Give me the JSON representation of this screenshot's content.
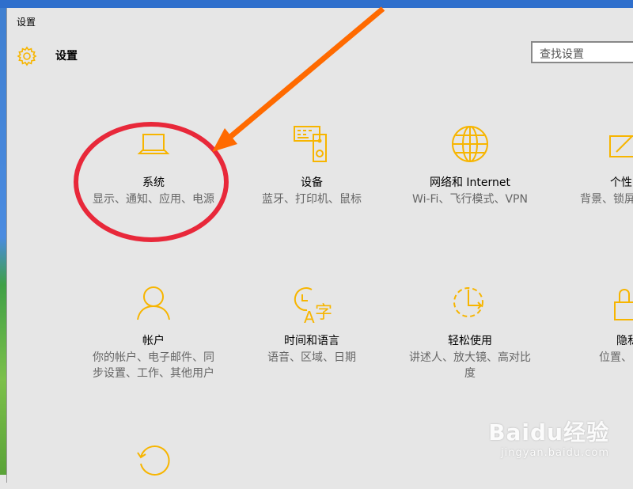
{
  "window": {
    "title": "设置"
  },
  "header": {
    "title": "设置",
    "search_placeholder": "查找设置"
  },
  "accent_color": "#f7b500",
  "annotation_colors": {
    "arrow": "#ff6a00",
    "circle": "#e8283a"
  },
  "tiles": [
    {
      "icon": "laptop-icon",
      "title": "系统",
      "desc": "显示、通知、应用、电源"
    },
    {
      "icon": "devices-icon",
      "title": "设备",
      "desc": "蓝牙、打印机、鼠标"
    },
    {
      "icon": "globe-icon",
      "title": "网络和 Internet",
      "desc": "Wi-Fi、飞行模式、VPN"
    },
    {
      "icon": "personalization-icon",
      "title": "个性",
      "desc": "背景、锁屏"
    },
    {
      "icon": "person-icon",
      "title": "帐户",
      "desc": "你的帐户、电子邮件、同步设置、工作、其他用户"
    },
    {
      "icon": "time-language-icon",
      "title": "时间和语言",
      "desc": "语音、区域、日期"
    },
    {
      "icon": "ease-of-access-icon",
      "title": "轻松使用",
      "desc": "讲述人、放大镜、高对比度"
    },
    {
      "icon": "lock-icon",
      "title": "隐私",
      "desc": "位置、"
    },
    {
      "icon": "update-icon",
      "title": "",
      "desc": ""
    }
  ],
  "watermark": {
    "main": "Baidu经验",
    "sub": "jingyan.baidu.com"
  }
}
